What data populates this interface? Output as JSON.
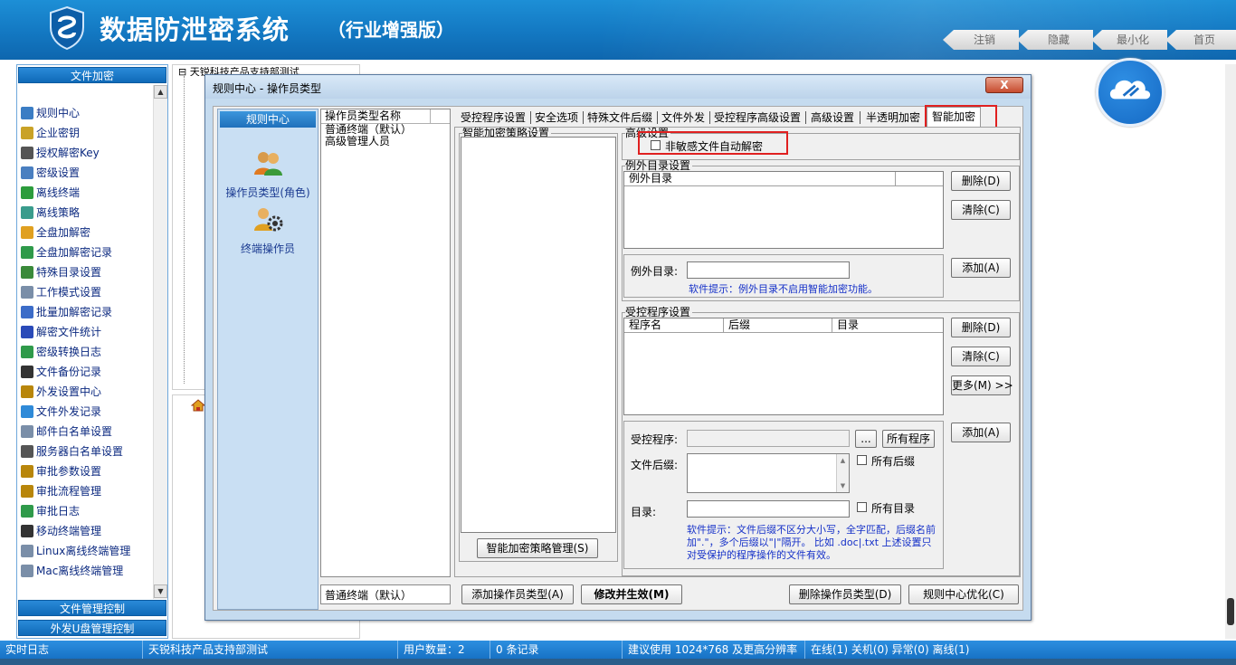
{
  "header": {
    "title": "数据防泄密系统",
    "subtitle": "（行业增强版）",
    "nav": [
      "注销",
      "隐藏",
      "最小化",
      "首页"
    ]
  },
  "sidebar": {
    "top_section": "文件加密",
    "items": [
      {
        "label": "规则中心",
        "icon": "rules-icon",
        "color": "#3b7dc4"
      },
      {
        "label": "企业密钥",
        "icon": "key-icon",
        "color": "#c9a227"
      },
      {
        "label": "授权解密Key",
        "icon": "printer-icon",
        "color": "#555555"
      },
      {
        "label": "密级设置",
        "icon": "gear-icon",
        "color": "#4a7fc0"
      },
      {
        "label": "离线终端",
        "icon": "check-icon",
        "color": "#2c9c3c"
      },
      {
        "label": "离线策略",
        "icon": "shield-icon",
        "color": "#3a9c8c"
      },
      {
        "label": "全盘加解密",
        "icon": "disk-icon",
        "color": "#e0a020"
      },
      {
        "label": "全盘加解密记录",
        "icon": "record-icon",
        "color": "#2f9a4a"
      },
      {
        "label": "特殊目录设置",
        "icon": "folder-icon",
        "color": "#3a8a3a"
      },
      {
        "label": "工作模式设置",
        "icon": "monitor-icon",
        "color": "#7a8ea8"
      },
      {
        "label": "批量加解密记录",
        "icon": "batch-icon",
        "color": "#3c6cc8"
      },
      {
        "label": "解密文件统计",
        "icon": "chart-icon",
        "color": "#2a4ab8"
      },
      {
        "label": "密级转换日志",
        "icon": "log-icon",
        "color": "#2f9a4a"
      },
      {
        "label": "文件备份记录",
        "icon": "book-icon",
        "color": "#333333"
      },
      {
        "label": "外发设置中心",
        "icon": "cog-icon",
        "color": "#b8860b"
      },
      {
        "label": "文件外发记录",
        "icon": "globe-icon",
        "color": "#2f8ad8"
      },
      {
        "label": "邮件白名单设置",
        "icon": "mail-icon",
        "color": "#7a8ea8"
      },
      {
        "label": "服务器白名单设置",
        "icon": "server-icon",
        "color": "#555555"
      },
      {
        "label": "审批参数设置",
        "icon": "settings-icon",
        "color": "#b8860b"
      },
      {
        "label": "审批流程管理",
        "icon": "flow-icon",
        "color": "#b8860b"
      },
      {
        "label": "审批日志",
        "icon": "list-icon",
        "color": "#2f9a4a"
      },
      {
        "label": "移动终端管理",
        "icon": "mobile-icon",
        "color": "#333333"
      },
      {
        "label": "Linux离线终端管理",
        "icon": "linux-icon",
        "color": "#7a8ea8"
      },
      {
        "label": "Mac离线终端管理",
        "icon": "mac-icon",
        "color": "#7a8ea8"
      }
    ],
    "bottom_sections": [
      "文件管理控制",
      "外发U盘管理控制"
    ]
  },
  "tree": {
    "root_label": "天锐科技产品支持部测试"
  },
  "dialog": {
    "title": "规则中心 - 操作员类型",
    "close_label": "X",
    "role_panel": {
      "header": "规则中心",
      "items": [
        "操作员类型(角色)",
        "终端操作员"
      ]
    },
    "type_list": {
      "header": "操作员类型名称",
      "rows": [
        "普通终端（默认）",
        "高级管理人员"
      ],
      "selected_value": "普通终端（默认）"
    },
    "tabs": [
      "受控程序设置",
      "安全选项",
      "特殊文件后缀",
      "文件外发",
      "受控程序高级设置",
      "高级设置",
      "半透明加密",
      "智能加密"
    ],
    "active_tab": "智能加密",
    "strategy": {
      "title": "智能加密策略设置",
      "manage_button": "智能加密策略管理(S)"
    },
    "advanced": {
      "title": "高级设置",
      "checkbox_label": "非敏感文件自动解密",
      "checked": false
    },
    "exception": {
      "title": "例外目录设置",
      "column": "例外目录",
      "delete_button": "删除(D)",
      "clear_button": "清除(C)",
      "add_button": "添加(A)",
      "input_label": "例外目录:",
      "input_value": "",
      "tip": "软件提示：例外目录不启用智能加密功能。"
    },
    "controlled": {
      "title": "受控程序设置",
      "columns": [
        "程序名",
        "后缀",
        "目录"
      ],
      "delete_button": "删除(D)",
      "clear_button": "清除(C)",
      "more_button": "更多(M) >>",
      "add_button": "添加(A)",
      "program_label": "受控程序:",
      "browse_button": "...",
      "all_programs_button": "所有程序",
      "suffix_label": "文件后缀:",
      "all_suffix_label": "所有后缀",
      "dir_label": "目录:",
      "all_dir_label": "所有目录",
      "tip": "软件提示：文件后缀不区分大小写，全字匹配，后缀名前加\".\"，多个后缀以\"|\"隔开。 比如 .doc|.txt 上述设置只对受保护的程序操作的文件有效。"
    },
    "footer": {
      "add_type_button": "添加操作员类型(A)",
      "apply_button": "修改并生效(M)",
      "delete_type_button": "删除操作员类型(D)",
      "optimize_button": "规则中心优化(C)"
    }
  },
  "statusbar": {
    "cells": [
      "实时日志",
      "天锐科技产品支持部测试",
      "用户数量：2",
      "0 条记录",
      "建议使用 1024*768 及更高分辨率",
      "在线(1) 关机(0) 异常(0) 离线(1)"
    ]
  },
  "colors": {
    "header_blue": "#1378c2",
    "accent_blue": "#1f70bb",
    "highlight_red": "#e02020"
  }
}
